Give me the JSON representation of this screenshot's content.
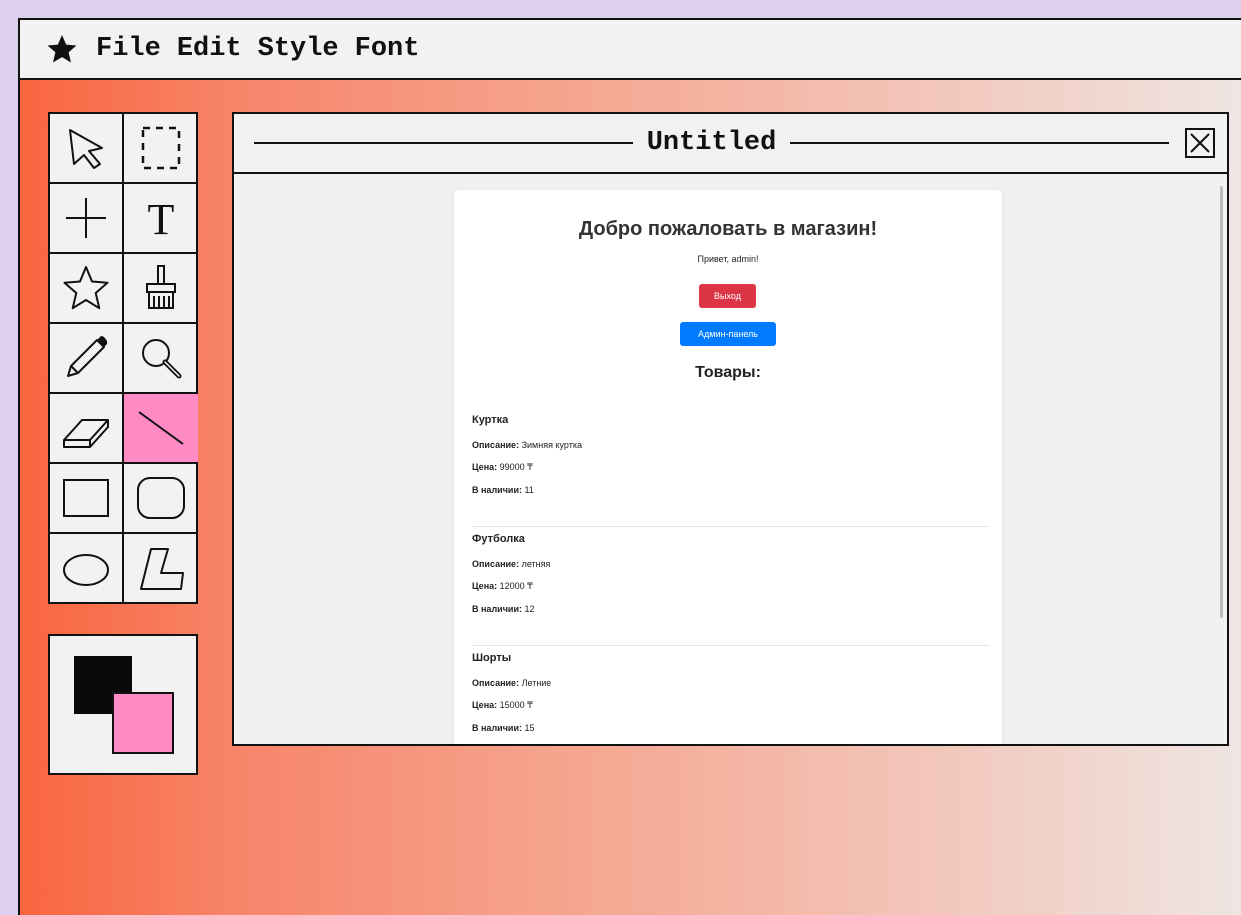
{
  "menubar": {
    "items": [
      "File",
      "Edit",
      "Style",
      "Font"
    ]
  },
  "tools": [
    {
      "icon": "arrow-select-icon"
    },
    {
      "icon": "marquee-select-icon"
    },
    {
      "icon": "crosshair-icon"
    },
    {
      "icon": "text-tool-icon",
      "label": "T"
    },
    {
      "icon": "star-shape-icon"
    },
    {
      "icon": "paint-brush-icon"
    },
    {
      "icon": "pencil-icon"
    },
    {
      "icon": "magnifier-icon"
    },
    {
      "icon": "eraser-icon"
    },
    {
      "icon": "line-tool-icon",
      "active": true
    },
    {
      "icon": "rectangle-icon"
    },
    {
      "icon": "rounded-rectangle-icon"
    },
    {
      "icon": "ellipse-icon"
    },
    {
      "icon": "polygon-icon"
    }
  ],
  "colors": {
    "foreground": "#0a0a0a",
    "background": "#ff8ac4",
    "accent": "#ff8ac4"
  },
  "document": {
    "title": "Untitled",
    "page": {
      "heading": "Добро пожаловать в магазин!",
      "greeting": "Привет, admin!",
      "logout_label": "Выход",
      "admin_label": "Админ-панель",
      "products_heading": "Товары:",
      "labels": {
        "description": "Описание:",
        "price": "Цена:",
        "stock": "В наличии:"
      },
      "products": [
        {
          "name": "Куртка",
          "description": "Зимняя куртка",
          "price": "99000 ₸",
          "stock": "11"
        },
        {
          "name": "Футболка",
          "description": "летняя",
          "price": "12000 ₸",
          "stock": "12"
        },
        {
          "name": "Шорты",
          "description": "Летние",
          "price": "15000 ₸",
          "stock": "15"
        }
      ]
    }
  }
}
